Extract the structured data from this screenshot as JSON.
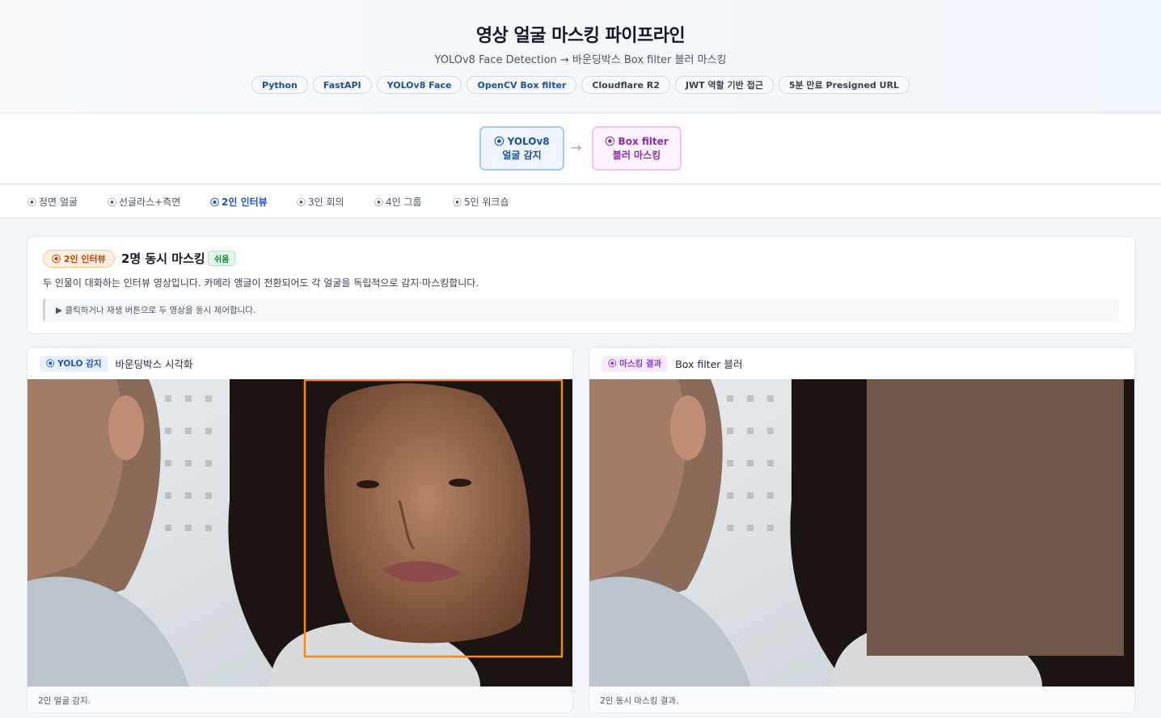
{
  "header": {
    "title": "영상 얼굴 마스킹 파이프라인",
    "subtitle": "YOLOv8 Face Detection → 바운딩박스 Box filter 블러 마스킹",
    "tags": [
      "Python",
      "FastAPI",
      "YOLOv8 Face",
      "OpenCV Box filter",
      "Cloudflare R2",
      "JWT 역할 기반 접근",
      "5분 만료 Presigned URL"
    ]
  },
  "pipeline": {
    "stage1": {
      "icon": "⦿",
      "line1": "YOLOv8",
      "line2": "얼굴 감지"
    },
    "arrow": "→",
    "stage2": {
      "icon": "⦿",
      "line1": "Box filter",
      "line2": "블러 마스킹"
    }
  },
  "tabs": [
    {
      "label": "정면 얼굴",
      "icon": "⦿"
    },
    {
      "label": "선글라스+측면",
      "icon": "⦿"
    },
    {
      "label": "2인 인터뷰",
      "icon": "⦿"
    },
    {
      "label": "3인 회의",
      "icon": "⦿"
    },
    {
      "label": "4인 그룹",
      "icon": "⦿"
    },
    {
      "label": "5인 워크숍",
      "icon": "⦿"
    }
  ],
  "active_tab": "2인 인터뷰",
  "info": {
    "badge": "⦿ 2인 인터뷰",
    "title": "2명 동시 마스킹",
    "difficulty": "쉬움",
    "description": "두 인물이 대화하는 인터뷰 영상입니다. 카메라 앵글이 전환되어도 각 얼굴을 독립적으로 감지·마스킹합니다.",
    "hint": "▶ 클릭하거나 재생 버튼으로 두 영상을 동시 제어합니다."
  },
  "panels": {
    "left": {
      "chip": "⦿ YOLO 감지",
      "label": "바운딩박스 시각화",
      "caption": "2인 얼굴 감지."
    },
    "right": {
      "chip": "⦿ 마스킹 결과",
      "label": "Box filter 블러",
      "caption": "2인 동시 마스킹 결과."
    }
  },
  "colors": {
    "accent_blue": "#1d4ed8",
    "detect_box": "#f28a1d",
    "blur_mask": "#6a5447"
  }
}
